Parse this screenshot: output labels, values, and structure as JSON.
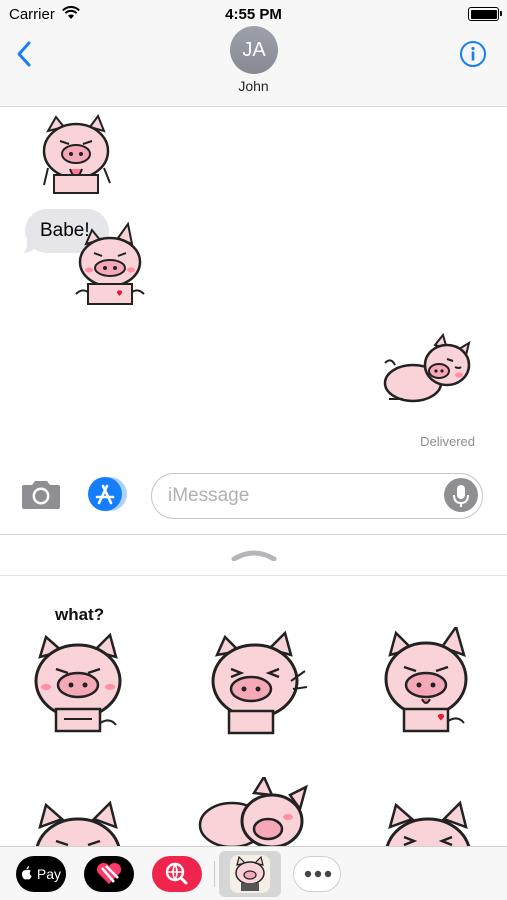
{
  "status": {
    "carrier": "Carrier",
    "time": "4:55 PM",
    "battery_level": 1.0
  },
  "header": {
    "avatar_initials": "JA",
    "contact_name": "John"
  },
  "conversation": {
    "message_text": "Babe!",
    "delivery_status": "Delivered"
  },
  "composer": {
    "placeholder": "iMessage"
  },
  "drawer": {
    "caption": "what?"
  },
  "app_strip": {
    "apple_pay_label": "Pay"
  },
  "colors": {
    "accent": "#157efb",
    "pig_pink": "#f9d3d8",
    "bubble_gray": "#e5e5ea",
    "search_app": "#f0254e"
  },
  "icons": [
    "back-chevron-icon",
    "info-icon",
    "camera-icon",
    "app-store-icon",
    "microphone-icon",
    "handle-icon",
    "apple-icon",
    "heart-icon",
    "globe-search-icon",
    "more-icon"
  ]
}
